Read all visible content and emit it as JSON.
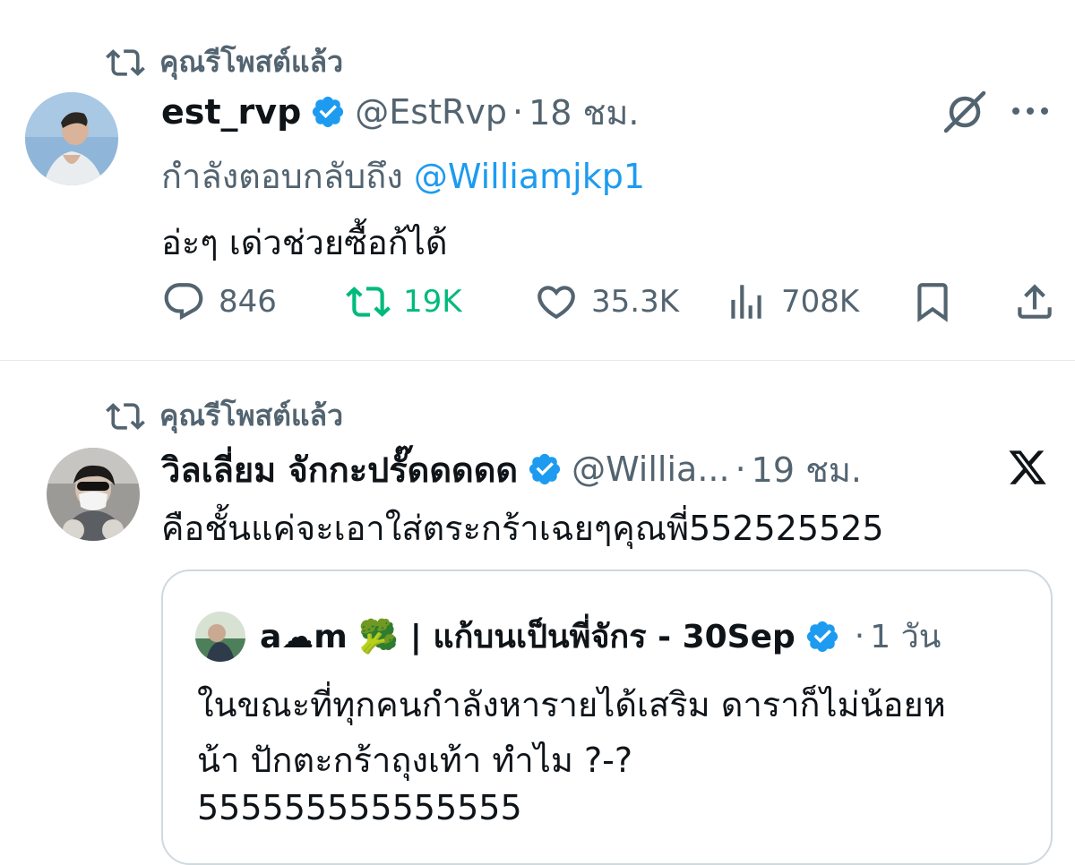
{
  "tweets": [
    {
      "repost_label": "คุณรีโพสต์แล้ว",
      "display_name": "est_rvp",
      "handle": "@EstRvp",
      "separator": "·",
      "time": "18 ชม.",
      "reply_prefix": "กำลังตอบกลับถึง",
      "reply_mention": "@Williamjkp1",
      "text": "อ่ะๆ เด่วช่วยซื้อก้ได้",
      "actions": {
        "replies": "846",
        "reposts": "19K",
        "likes": "35.3K",
        "views": "708K"
      },
      "reposted": true
    },
    {
      "repost_label": "คุณรีโพสต์แล้ว",
      "display_name": "วิลเลี่ยม จักกะปรั๊ดดดดด",
      "handle": "@Willia...",
      "separator": "·",
      "time": "19 ชม.",
      "text": "คือชั้นแค่จะเอาใส่ตระกร้าเฉยๆคุณพี่552525525",
      "quote": {
        "display_name": "a☁m 🥦 | แก้บนเป็นพี่จักร - 30Sep",
        "separator": "·",
        "time": "1 วัน",
        "lines": [
          "ในขณะที่ทุกคนกำลังหารายได้เสริม ดาราก็ไม่น้อยห",
          "น้า ปักตะกร้าถุงเท้า ทำไม ?-?",
          "555555555555555"
        ]
      }
    }
  ],
  "icons": {
    "repost": "repost-icon",
    "verified": "verified-badge-icon",
    "grok": "grok-icon",
    "more": "more-dots-icon",
    "x_logo": "x-logo-icon",
    "reply": "reply-icon",
    "like": "heart-icon",
    "views": "views-icon",
    "bookmark": "bookmark-icon",
    "share": "share-icon"
  },
  "colors": {
    "text_primary": "#0f1419",
    "text_secondary": "#536471",
    "link": "#1d9bf0",
    "verified": "#1d9bf0",
    "repost_active": "#00ba7c",
    "border": "#cfd9de"
  }
}
